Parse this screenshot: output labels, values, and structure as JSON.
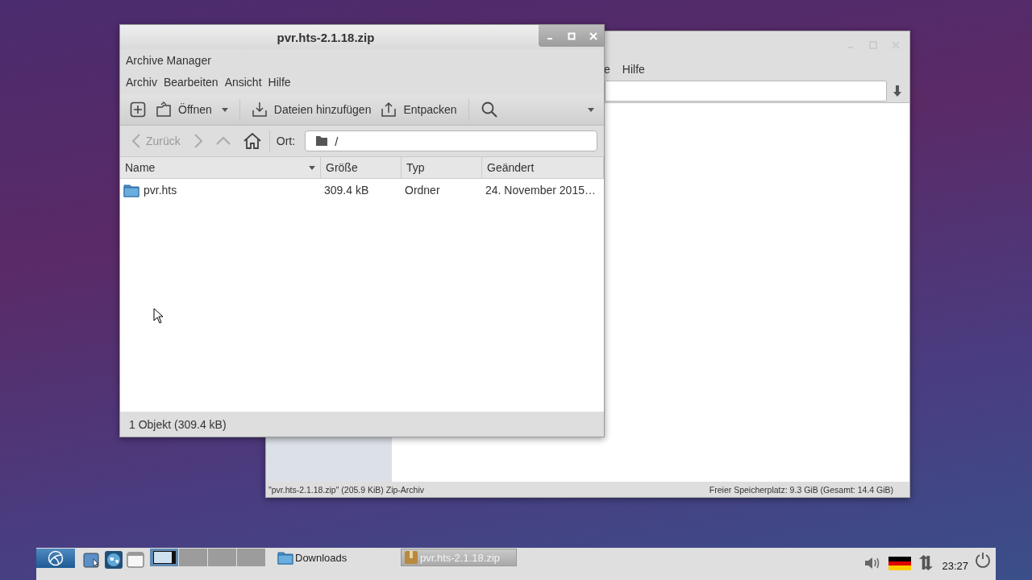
{
  "back_window": {
    "menu": [
      "e",
      "Hilfe"
    ],
    "status_left": "\"pvr.hts-2.1.18.zip\" (205.9 KiB) Zip-Archiv",
    "status_right": "Freier Speicherplatz: 9.3 GiB (Gesamt: 14.4 GiB)"
  },
  "window": {
    "title": "pvr.hts-2.1.18.zip",
    "app_name": "Archive Manager",
    "menu": [
      "Archiv",
      "Bearbeiten",
      "Ansicht",
      "Hilfe"
    ],
    "toolbar": [
      {
        "kind": "new"
      },
      {
        "kind": "open",
        "label": "Öffnen"
      },
      {
        "kind": "add",
        "label": "Dateien hinzufügen"
      },
      {
        "kind": "extract",
        "label": "Entpacken"
      },
      {
        "kind": "search"
      }
    ],
    "nav": [
      {
        "kind": "back",
        "label": "Zurück",
        "disabled": true
      },
      {
        "kind": "forward",
        "disabled": true
      },
      {
        "kind": "up",
        "disabled": true
      },
      {
        "kind": "home",
        "disabled": false
      }
    ],
    "location_label": "Ort:",
    "location": "/",
    "columns": [
      "Name",
      "Größe",
      "Typ",
      "Geändert"
    ],
    "rows": [
      {
        "name": "pvr.hts",
        "size": "309.4 kB",
        "type": "Ordner",
        "modified": "24. November 2015…",
        "selected": false
      }
    ],
    "status": "1 Objekt (309.4 kB)"
  },
  "taskbar": {
    "pager": [
      {
        "selected": true
      },
      {
        "selected": false
      },
      {
        "selected": false
      },
      {
        "selected": false
      }
    ],
    "tasks": [
      {
        "kind": "folder",
        "label": "Downloads",
        "selected": false
      },
      {
        "kind": "archive",
        "label": "pvr.hts-2.1.18.zip",
        "selected": true
      }
    ],
    "clock": "23:27"
  }
}
